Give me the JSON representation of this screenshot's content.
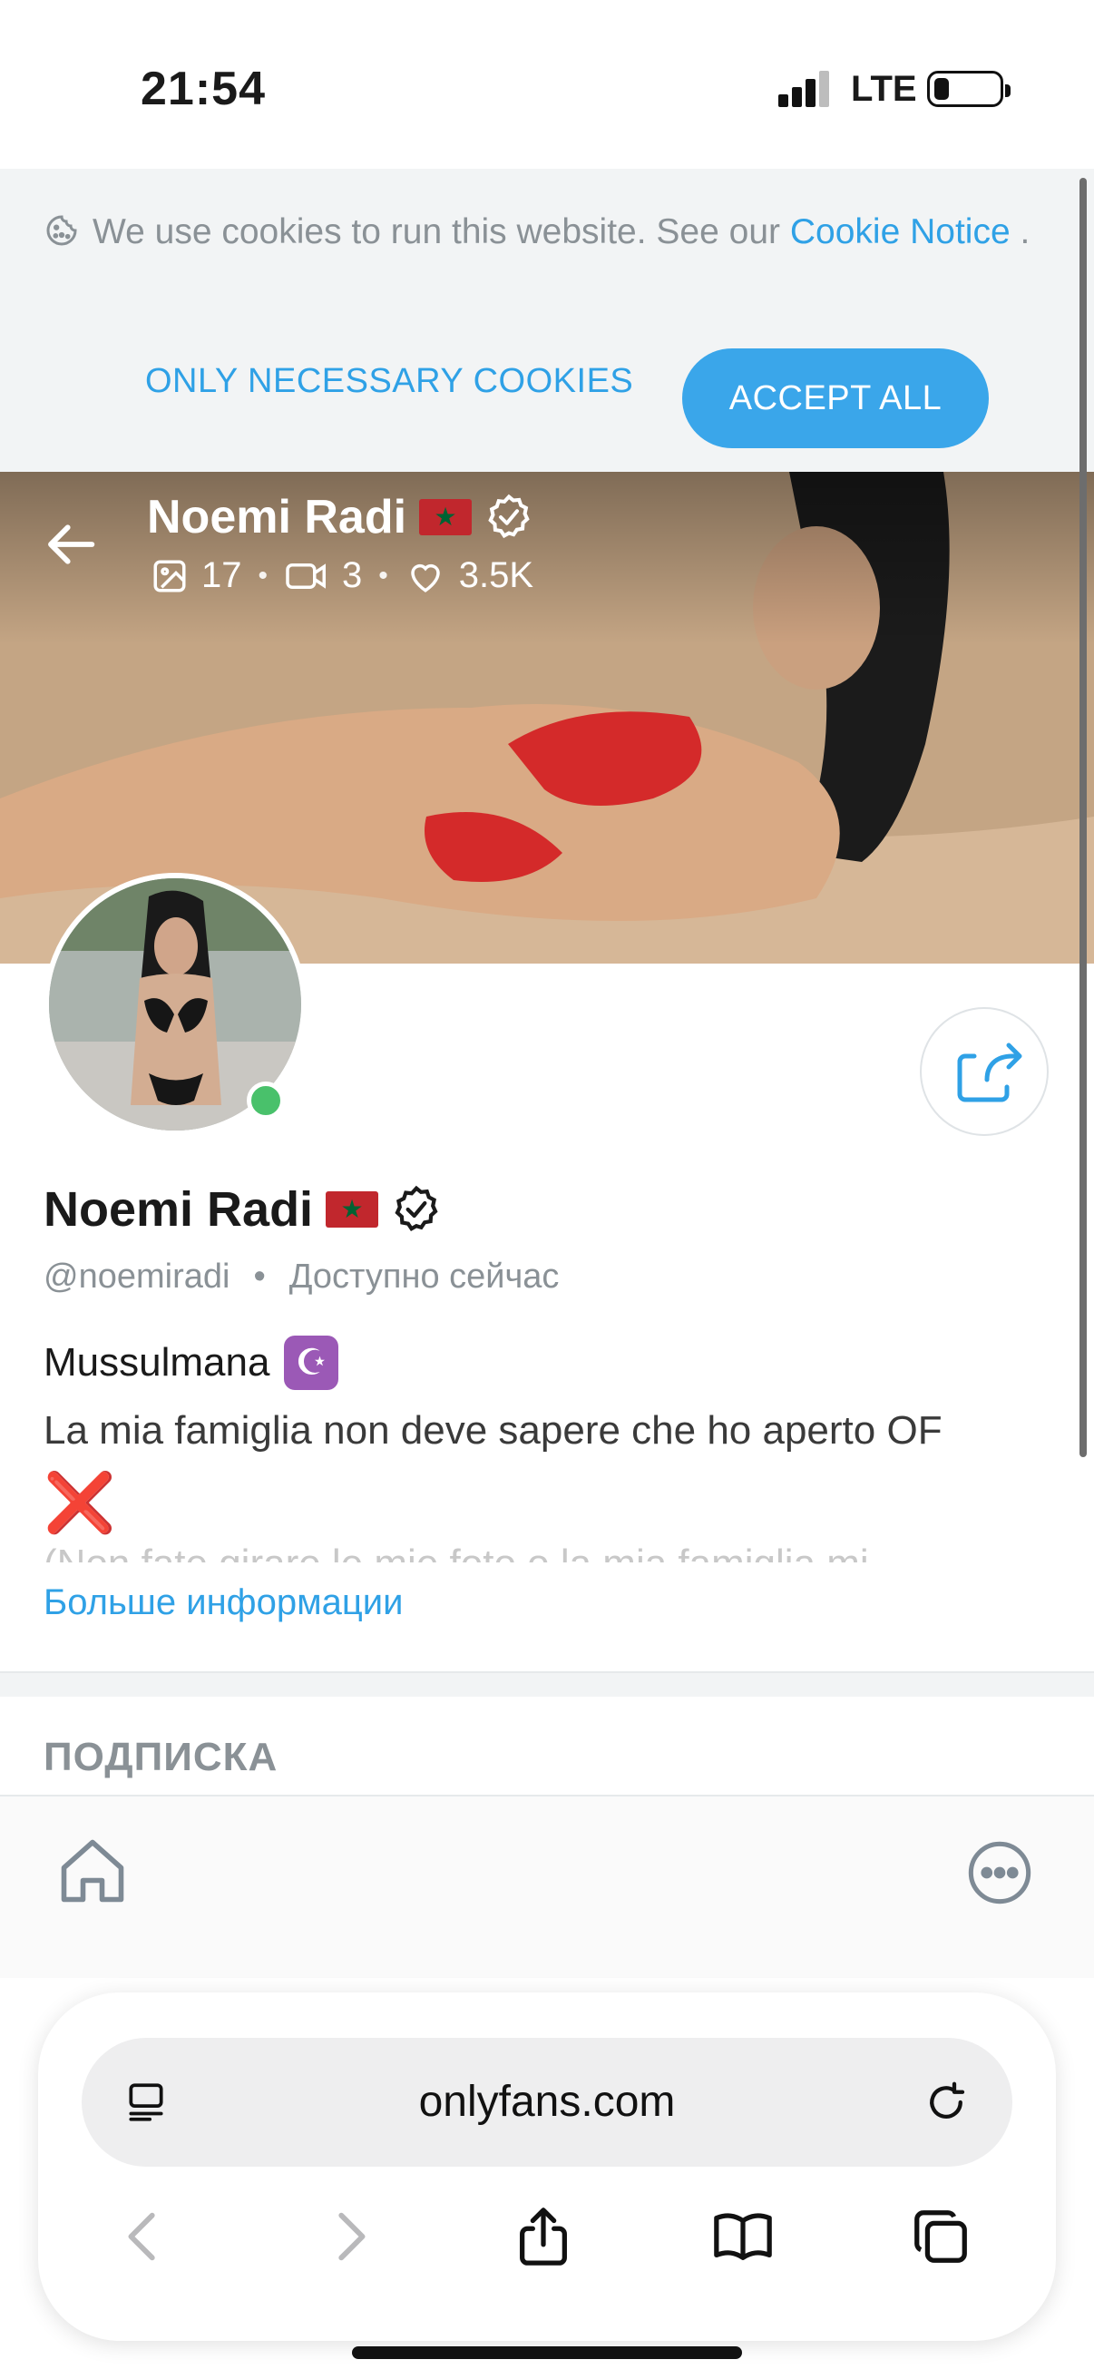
{
  "status_bar": {
    "time": "21:54",
    "network": "LTE"
  },
  "cookie_banner": {
    "text": "We use cookies to run this website. See our",
    "link": "Cookie Notice",
    "suffix": ".",
    "necessary_label": "ONLY NECESSARY COOKIES",
    "accept_label": "ACCEPT ALL"
  },
  "cover": {
    "name": "Noemi Radi",
    "photos": "17",
    "videos": "3",
    "likes": "3.5K"
  },
  "profile": {
    "name": "Noemi Radi",
    "handle": "@noemiradi",
    "availability": "Доступно сейчас",
    "bio_line1": "Mussulmana",
    "bio_line1_emoji": "☪",
    "bio_line2": "La mia famiglia non deve sapere che ho aperto OF",
    "bio_line2_emoji": "❌",
    "bio_line3": "(Non fate girare le mie foto o la mia famiglia mi",
    "more_info": "Больше информации"
  },
  "subscription": {
    "title": "ПОДПИСКА"
  },
  "browser": {
    "url": "onlyfans.com"
  },
  "colors": {
    "accent": "#3aa6ea",
    "online": "#49c16b",
    "muted": "#8a9196"
  }
}
